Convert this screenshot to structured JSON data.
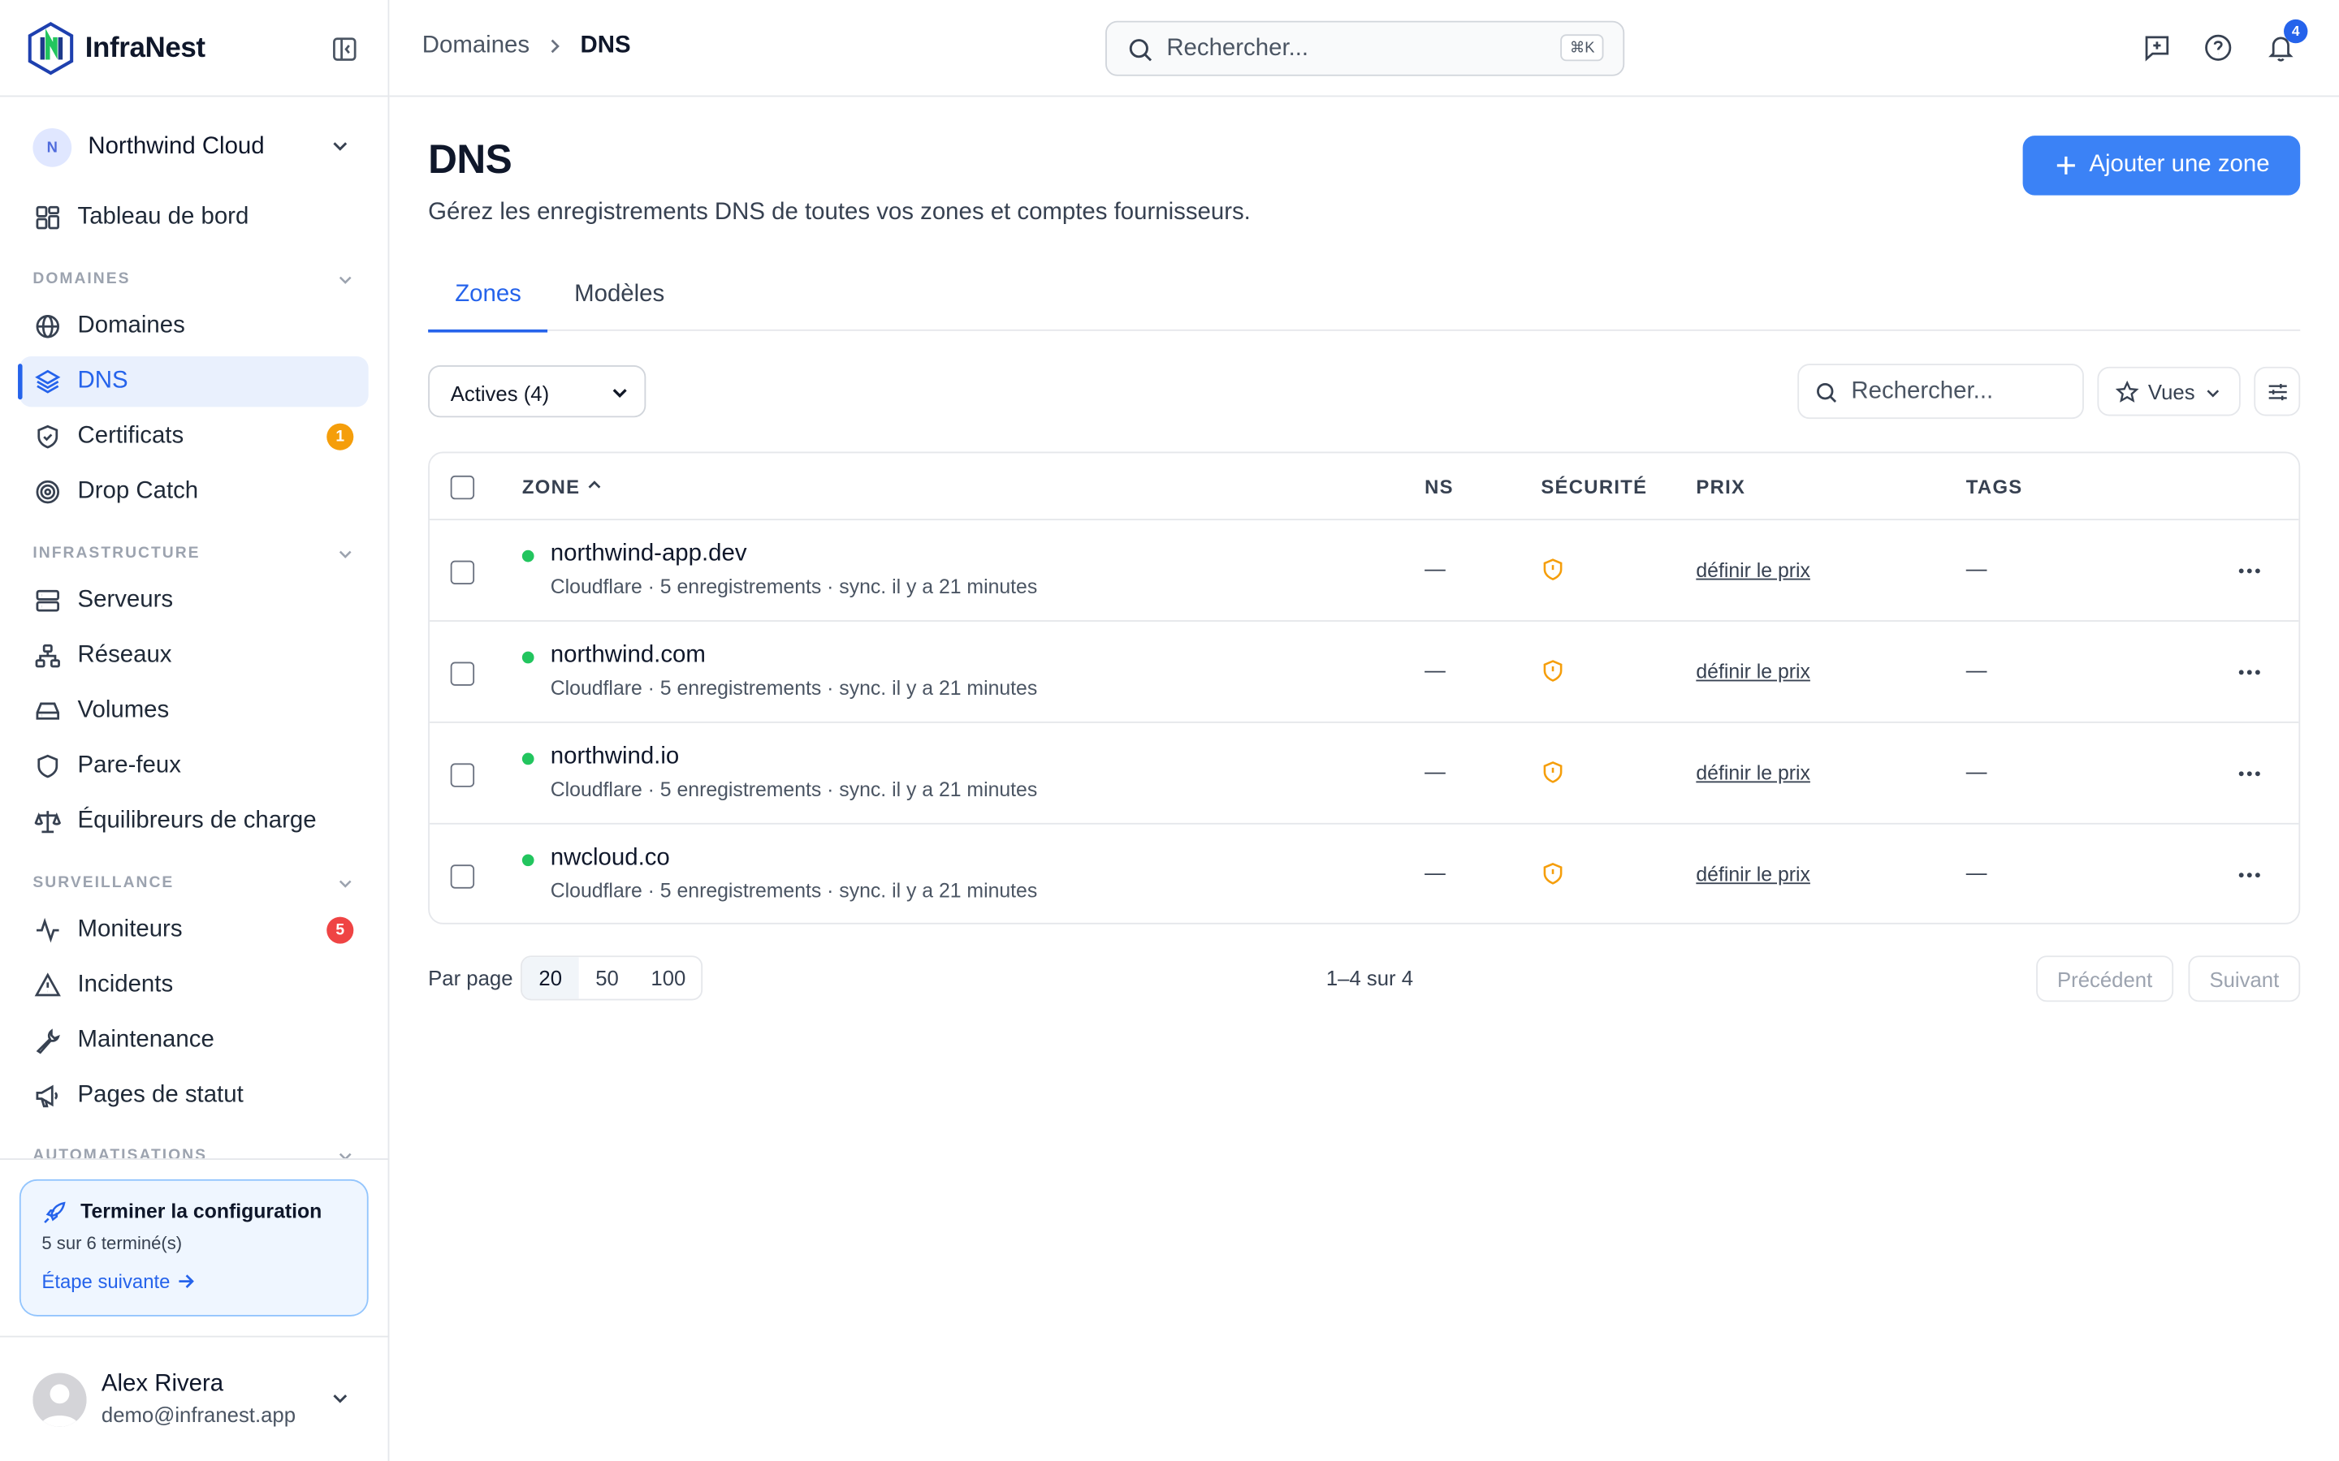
{
  "brand": {
    "name": "InfraNest"
  },
  "org": {
    "initial": "N",
    "name": "Northwind Cloud"
  },
  "nav": {
    "dashboard": "Tableau de bord",
    "sections": {
      "domaines": "DOMAINES",
      "infrastructure": "INFRASTRUCTURE",
      "surveillance": "SURVEILLANCE",
      "automatisations": "AUTOMATISATIONS"
    },
    "items": {
      "domaines": "Domaines",
      "dns": "DNS",
      "certificats": "Certificats",
      "drop_catch": "Drop Catch",
      "serveurs": "Serveurs",
      "reseaux": "Réseaux",
      "volumes": "Volumes",
      "pare_feux": "Pare-feux",
      "equilibreurs": "Équilibreurs de charge",
      "moniteurs": "Moniteurs",
      "incidents": "Incidents",
      "maintenance": "Maintenance",
      "pages_statut": "Pages de statut"
    },
    "badges": {
      "certificats": "1",
      "moniteurs": "5"
    },
    "badge_colors": {
      "warning": "#f59e0b",
      "danger": "#ef4444"
    },
    "active_item": "dns"
  },
  "setup": {
    "title": "Terminer la configuration",
    "progress_text": "5 sur 6 terminé(s)",
    "completed": 5,
    "total": 6,
    "next_label": "Étape suivante"
  },
  "user": {
    "name": "Alex Rivera",
    "email": "demo@infranest.app"
  },
  "topbar": {
    "breadcrumb": [
      "Domaines",
      "DNS"
    ],
    "search_placeholder": "Rechercher...",
    "shortcut": "⌘K",
    "icons": [
      "feedback-icon",
      "help-icon",
      "bell-icon"
    ],
    "notification_count": "4"
  },
  "page": {
    "title": "DNS",
    "subtitle": "Gérez les enregistrements DNS de toutes vos zones et comptes fournisseurs.",
    "add_button": "Ajouter une zone",
    "tabs": [
      "Zones",
      "Modèles"
    ],
    "active_tab": "Zones"
  },
  "toolbar": {
    "filter_value": "Actives (4)",
    "search_placeholder": "Rechercher...",
    "views_label": "Vues"
  },
  "table": {
    "columns": {
      "zone": "ZONE",
      "ns": "NS",
      "security": "SÉCURITÉ",
      "price": "PRIX",
      "tags": "TAGS"
    },
    "sort": {
      "column": "zone",
      "direction": "asc"
    },
    "rows": [
      {
        "name": "northwind-app.dev",
        "meta": "Cloudflare · 5 enregistrements · sync. il y a 21 minutes",
        "ns": "—",
        "price": "définir le prix",
        "tags": "—",
        "status": "active"
      },
      {
        "name": "northwind.com",
        "meta": "Cloudflare · 5 enregistrements · sync. il y a 21 minutes",
        "ns": "—",
        "price": "définir le prix",
        "tags": "—",
        "status": "active"
      },
      {
        "name": "northwind.io",
        "meta": "Cloudflare · 5 enregistrements · sync. il y a 21 minutes",
        "ns": "—",
        "price": "définir le prix",
        "tags": "—",
        "status": "active"
      },
      {
        "name": "nwcloud.co",
        "meta": "Cloudflare · 5 enregistrements · sync. il y a 21 minutes",
        "ns": "—",
        "price": "définir le prix",
        "tags": "—",
        "status": "active"
      }
    ]
  },
  "pagination": {
    "per_page_label": "Par page",
    "options": [
      "20",
      "50",
      "100"
    ],
    "selected": "20",
    "range": "1–4 sur 4",
    "prev": "Précédent",
    "next": "Suivant"
  },
  "colors": {
    "accent": "#2563eb",
    "primary_button": "#3b82f6",
    "status_active": "#22c55e",
    "security_warning": "#f59e0b"
  }
}
